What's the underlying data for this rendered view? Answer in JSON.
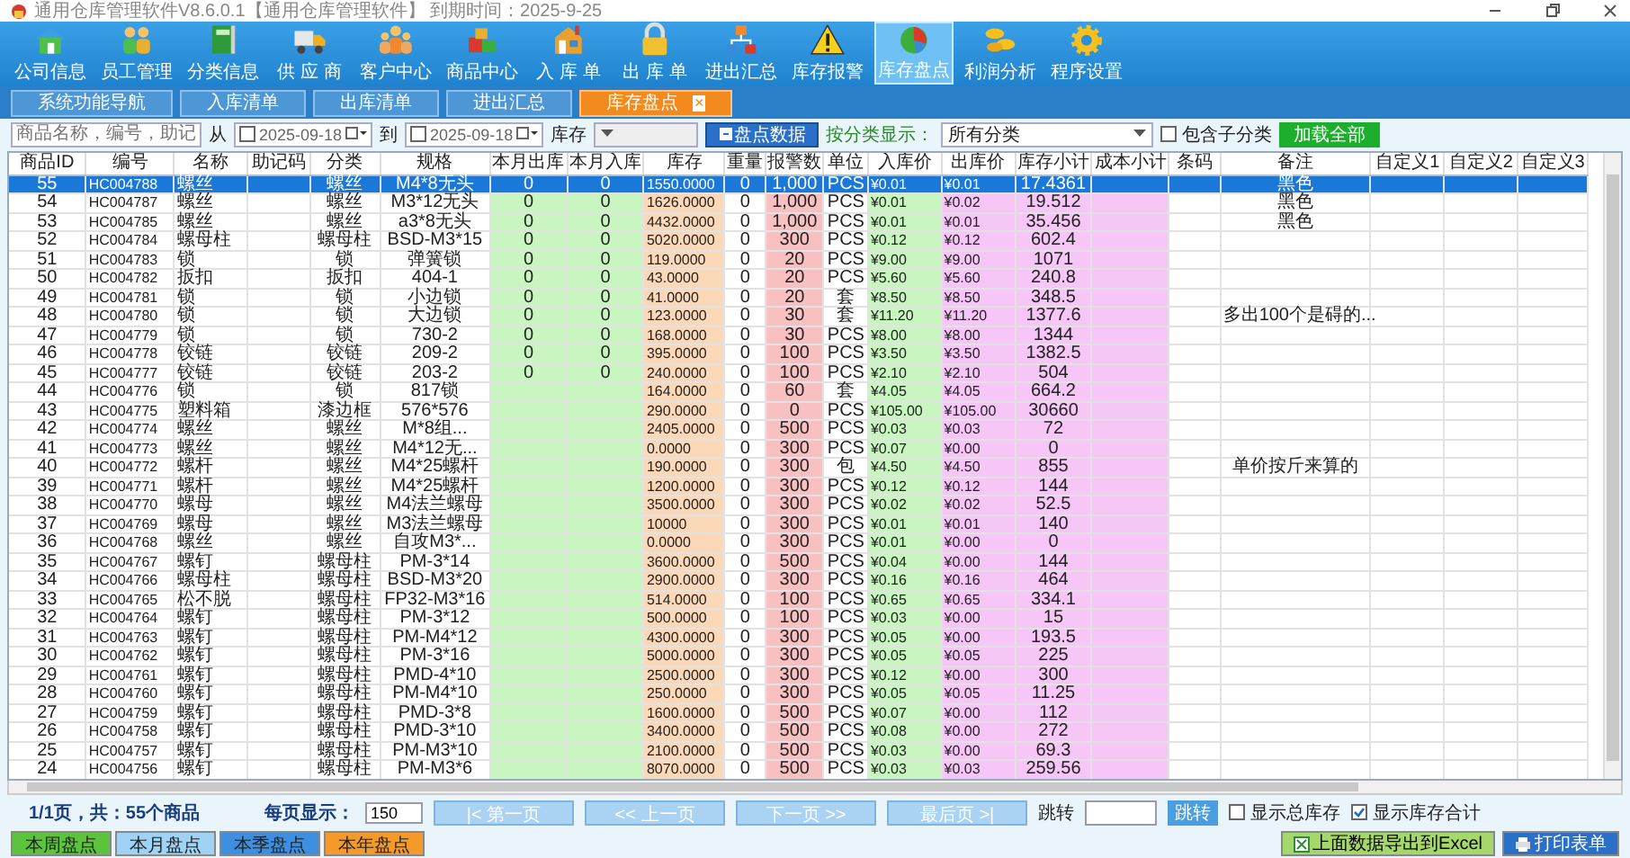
{
  "window": {
    "title": "通用仓库管理软件V8.6.0.1【通用仓库管理软件】 到期时间：2025-9-25"
  },
  "toolbar": [
    {
      "label": "公司信息",
      "selected": false
    },
    {
      "label": "员工管理",
      "selected": false
    },
    {
      "label": "分类信息",
      "selected": false
    },
    {
      "label": "供 应 商",
      "selected": false
    },
    {
      "label": "客户中心",
      "selected": false
    },
    {
      "label": "商品中心",
      "selected": false
    },
    {
      "label": "入 库 单",
      "selected": false
    },
    {
      "label": "出 库 单",
      "selected": false
    },
    {
      "label": "进出汇总",
      "selected": false
    },
    {
      "label": "库存报警",
      "selected": false
    },
    {
      "label": "库存盘点",
      "selected": true
    },
    {
      "label": "利润分析",
      "selected": false
    },
    {
      "label": "程序设置",
      "selected": false
    }
  ],
  "tabs": [
    {
      "label": "系统功能导航",
      "selected": false
    },
    {
      "label": "入库清单",
      "selected": false
    },
    {
      "label": "出库清单",
      "selected": false
    },
    {
      "label": "进出汇总",
      "selected": false
    },
    {
      "label": "库存盘点",
      "selected": true,
      "close": "×"
    }
  ],
  "filter": {
    "search": {
      "placeholder": "商品名称，编号，助记"
    },
    "from_label": "从",
    "from": {
      "checked": false,
      "value": "2025-09-18"
    },
    "to_label": "到",
    "to": {
      "checked": false,
      "value": "2025-09-18"
    },
    "stock_label": "库存",
    "query_button": "盘点数据",
    "category_label": "按分类显示：",
    "category": "所有分类",
    "include_sub": {
      "label": "包含子分类",
      "checked": false
    },
    "load_all": "加载全部"
  },
  "table": {
    "columns": [
      "商品ID",
      "编号",
      "名称",
      "助记码",
      "分类",
      "规格",
      "本月出库",
      "本月入库",
      "库存",
      "重量",
      "报警数",
      "单位",
      "入库价",
      "出库价",
      "库存小计",
      "成本小计",
      "条码",
      "备注",
      "自定义1",
      "自定义2",
      "自定义3"
    ],
    "rows": [
      {
        "selected": true,
        "cells": [
          "55",
          "HC004788",
          "螺丝",
          null,
          "螺丝",
          "M4*8无头",
          "0",
          "0",
          "1550.0000",
          "0",
          "1,000",
          "PCS",
          "¥0.01",
          "¥0.01",
          "17.4361",
          null,
          null,
          "黑色"
        ]
      },
      {
        "selected": false,
        "cells": [
          "54",
          "HC004787",
          "螺丝",
          null,
          "螺丝",
          "M3*12无头",
          "0",
          "0",
          "1626.0000",
          "0",
          "1,000",
          "PCS",
          "¥0.01",
          "¥0.02",
          "19.512",
          null,
          null,
          "黑色"
        ]
      },
      {
        "selected": false,
        "cells": [
          "53",
          "HC004785",
          "螺丝",
          null,
          "螺丝",
          "a3*8无头",
          "0",
          "0",
          "4432.0000",
          "0",
          "1,000",
          "PCS",
          "¥0.01",
          "¥0.01",
          "35.456",
          null,
          null,
          "黑色"
        ]
      },
      {
        "selected": false,
        "cells": [
          "52",
          "HC004784",
          "螺母柱",
          null,
          "螺母柱",
          "BSD-M3*15",
          "0",
          "0",
          "5020.0000",
          "0",
          "300",
          "PCS",
          "¥0.12",
          "¥0.12",
          "602.4"
        ]
      },
      {
        "selected": false,
        "cells": [
          "51",
          "HC004783",
          "锁",
          null,
          "锁",
          "弹簧锁",
          "0",
          "0",
          "119.0000",
          "0",
          "20",
          "PCS",
          "¥9.00",
          "¥9.00",
          "1071"
        ]
      },
      {
        "selected": false,
        "cells": [
          "50",
          "HC004782",
          "扳扣",
          null,
          "扳扣",
          "404-1",
          "0",
          "0",
          "43.0000",
          "0",
          "20",
          "PCS",
          "¥5.60",
          "¥5.60",
          "240.8"
        ]
      },
      {
        "selected": false,
        "cells": [
          "49",
          "HC004781",
          "锁",
          null,
          "锁",
          "小边锁",
          "0",
          "0",
          "41.0000",
          "0",
          "20",
          "套",
          "¥8.50",
          "¥8.50",
          "348.5"
        ]
      },
      {
        "selected": false,
        "cells": [
          "48",
          "HC004780",
          "锁",
          null,
          "锁",
          "大边锁",
          "0",
          "0",
          "123.0000",
          "0",
          "30",
          "套",
          "¥11.20",
          "¥11.20",
          "1377.6",
          null,
          null,
          "多出100个是碍的..."
        ]
      },
      {
        "selected": false,
        "cells": [
          "47",
          "HC004779",
          "锁",
          null,
          "锁",
          "730-2",
          "0",
          "0",
          "168.0000",
          "0",
          "30",
          "PCS",
          "¥8.00",
          "¥8.00",
          "1344"
        ]
      },
      {
        "selected": false,
        "cells": [
          "46",
          "HC004778",
          "铰链",
          null,
          "铰链",
          "209-2",
          "0",
          "0",
          "395.0000",
          "0",
          "100",
          "PCS",
          "¥3.50",
          "¥3.50",
          "1382.5"
        ]
      },
      {
        "selected": false,
        "cells": [
          "45",
          "HC004777",
          "铰链",
          null,
          "铰链",
          "203-2",
          "0",
          "0",
          "240.0000",
          "0",
          "100",
          "PCS",
          "¥2.10",
          "¥2.10",
          "504"
        ]
      },
      {
        "selected": false,
        "cells": [
          "44",
          "HC004776",
          "锁",
          null,
          "锁",
          "817锁",
          null,
          null,
          "164.0000",
          "0",
          "60",
          "套",
          "¥4.05",
          "¥4.05",
          "664.2"
        ]
      },
      {
        "selected": false,
        "cells": [
          "43",
          "HC004775",
          "塑料箱",
          null,
          "漆边框",
          "576*576",
          null,
          null,
          "290.0000",
          "0",
          "0",
          "PCS",
          "¥105.00",
          "¥105.00",
          "30660"
        ]
      },
      {
        "selected": false,
        "cells": [
          "42",
          "HC004774",
          "螺丝",
          null,
          "螺丝",
          "M*8组...",
          null,
          null,
          "2405.0000",
          "0",
          "500",
          "PCS",
          "¥0.03",
          "¥0.03",
          "72"
        ]
      },
      {
        "selected": false,
        "cells": [
          "41",
          "HC004773",
          "螺丝",
          null,
          "螺丝",
          "M4*12无...",
          null,
          null,
          "0.0000",
          "0",
          "300",
          "PCS",
          "¥0.07",
          "¥0.00",
          "0"
        ]
      },
      {
        "selected": false,
        "cells": [
          "40",
          "HC004772",
          "螺杆",
          null,
          "螺丝",
          "M4*25螺杆",
          null,
          null,
          "190.0000",
          "0",
          "300",
          "包",
          "¥4.50",
          "¥4.50",
          "855",
          null,
          null,
          "单价按斤来算的"
        ]
      },
      {
        "selected": false,
        "cells": [
          "39",
          "HC004771",
          "螺杆",
          null,
          "螺丝",
          "M4*25螺杆",
          null,
          null,
          "1200.0000",
          "0",
          "300",
          "PCS",
          "¥0.12",
          "¥0.12",
          "144"
        ]
      },
      {
        "selected": false,
        "cells": [
          "38",
          "HC004770",
          "螺母",
          null,
          "螺丝",
          "M4法兰螺母",
          null,
          null,
          "3500.0000",
          "0",
          "300",
          "PCS",
          "¥0.02",
          "¥0.02",
          "52.5"
        ]
      },
      {
        "selected": false,
        "cells": [
          "37",
          "HC004769",
          "螺母",
          null,
          "螺丝",
          "M3法兰螺母",
          null,
          null,
          "10000",
          "0",
          "300",
          "PCS",
          "¥0.01",
          "¥0.01",
          "140"
        ]
      },
      {
        "selected": false,
        "cells": [
          "36",
          "HC004768",
          "螺丝",
          null,
          "螺丝",
          "自攻M3*...",
          null,
          null,
          "0.0000",
          "0",
          "300",
          "PCS",
          "¥0.01",
          "¥0.00",
          "0"
        ]
      },
      {
        "selected": false,
        "cells": [
          "35",
          "HC004767",
          "螺钉",
          null,
          "螺母柱",
          "PM-3*14",
          null,
          null,
          "3600.0000",
          "0",
          "500",
          "PCS",
          "¥0.04",
          "¥0.00",
          "144"
        ]
      },
      {
        "selected": false,
        "cells": [
          "34",
          "HC004766",
          "螺母柱",
          null,
          "螺母柱",
          "BSD-M3*20",
          null,
          null,
          "2900.0000",
          "0",
          "300",
          "PCS",
          "¥0.16",
          "¥0.16",
          "464"
        ]
      },
      {
        "selected": false,
        "cells": [
          "33",
          "HC004765",
          "松不脱",
          null,
          "螺母柱",
          "FP32-M3*16",
          null,
          null,
          "514.0000",
          "0",
          "100",
          "PCS",
          "¥0.65",
          "¥0.65",
          "334.1"
        ]
      },
      {
        "selected": false,
        "cells": [
          "32",
          "HC004764",
          "螺钉",
          null,
          "螺母柱",
          "PM-3*12",
          null,
          null,
          "500.0000",
          "0",
          "100",
          "PCS",
          "¥0.03",
          "¥0.00",
          "15"
        ]
      },
      {
        "selected": false,
        "cells": [
          "31",
          "HC004763",
          "螺钉",
          null,
          "螺母柱",
          "PM-M4*12",
          null,
          null,
          "4300.0000",
          "0",
          "300",
          "PCS",
          "¥0.05",
          "¥0.00",
          "193.5"
        ]
      },
      {
        "selected": false,
        "cells": [
          "30",
          "HC004762",
          "螺钉",
          null,
          "螺母柱",
          "PM-3*16",
          null,
          null,
          "5000.0000",
          "0",
          "300",
          "PCS",
          "¥0.05",
          "¥0.05",
          "225"
        ]
      },
      {
        "selected": false,
        "cells": [
          "29",
          "HC004761",
          "螺钉",
          null,
          "螺母柱",
          "PMD-4*10",
          null,
          null,
          "2500.0000",
          "0",
          "300",
          "PCS",
          "¥0.12",
          "¥0.00",
          "300"
        ]
      },
      {
        "selected": false,
        "cells": [
          "28",
          "HC004760",
          "螺钉",
          null,
          "螺母柱",
          "PM-M4*10",
          null,
          null,
          "250.0000",
          "0",
          "300",
          "PCS",
          "¥0.05",
          "¥0.05",
          "11.25"
        ]
      },
      {
        "selected": false,
        "cells": [
          "27",
          "HC004759",
          "螺钉",
          null,
          "螺母柱",
          "PMD-3*8",
          null,
          null,
          "1600.0000",
          "0",
          "500",
          "PCS",
          "¥0.07",
          "¥0.00",
          "112"
        ]
      },
      {
        "selected": false,
        "cells": [
          "26",
          "HC004758",
          "螺钉",
          null,
          "螺母柱",
          "PMD-3*10",
          null,
          null,
          "3400.0000",
          "0",
          "500",
          "PCS",
          "¥0.08",
          "¥0.00",
          "272"
        ]
      },
      {
        "selected": false,
        "cells": [
          "25",
          "HC004757",
          "螺钉",
          null,
          "螺母柱",
          "PM-M3*10",
          null,
          null,
          "2100.0000",
          "0",
          "500",
          "PCS",
          "¥0.03",
          "¥0.00",
          "69.3"
        ]
      },
      {
        "selected": false,
        "cells": [
          "24",
          "HC004756",
          "螺钉",
          null,
          "螺母柱",
          "PM-M3*6",
          null,
          null,
          "8070.0000",
          "0",
          "500",
          "PCS",
          "¥0.03",
          "¥0.03",
          "259.56"
        ]
      }
    ]
  },
  "pager": {
    "summary": "1/1页，共：55个商品",
    "per_page_label": "每页显示：",
    "per_page": "150",
    "buttons": [
      "|< 第一页",
      "<< 上一页",
      "下一页 >>",
      "最后页 >|"
    ],
    "jump_label": "跳转",
    "jump_button": "跳转",
    "show_total_stock": {
      "label": "显示总库存",
      "checked": false
    },
    "show_stock_sum": {
      "label": "显示库存合计",
      "checked": true
    }
  },
  "period_tabs": [
    {
      "label": "本周盘点",
      "color": "#5cc43c"
    },
    {
      "label": "本月盘点",
      "color": "#9fd3f5"
    },
    {
      "label": "本季盘点",
      "color": "#3f8fe0"
    },
    {
      "label": "本年盘点",
      "color": "#f39a2b"
    }
  ],
  "actions": [
    {
      "label": "上面数据导出到Excel",
      "kind": "excel"
    },
    {
      "label": "打印表单",
      "kind": "print"
    }
  ]
}
